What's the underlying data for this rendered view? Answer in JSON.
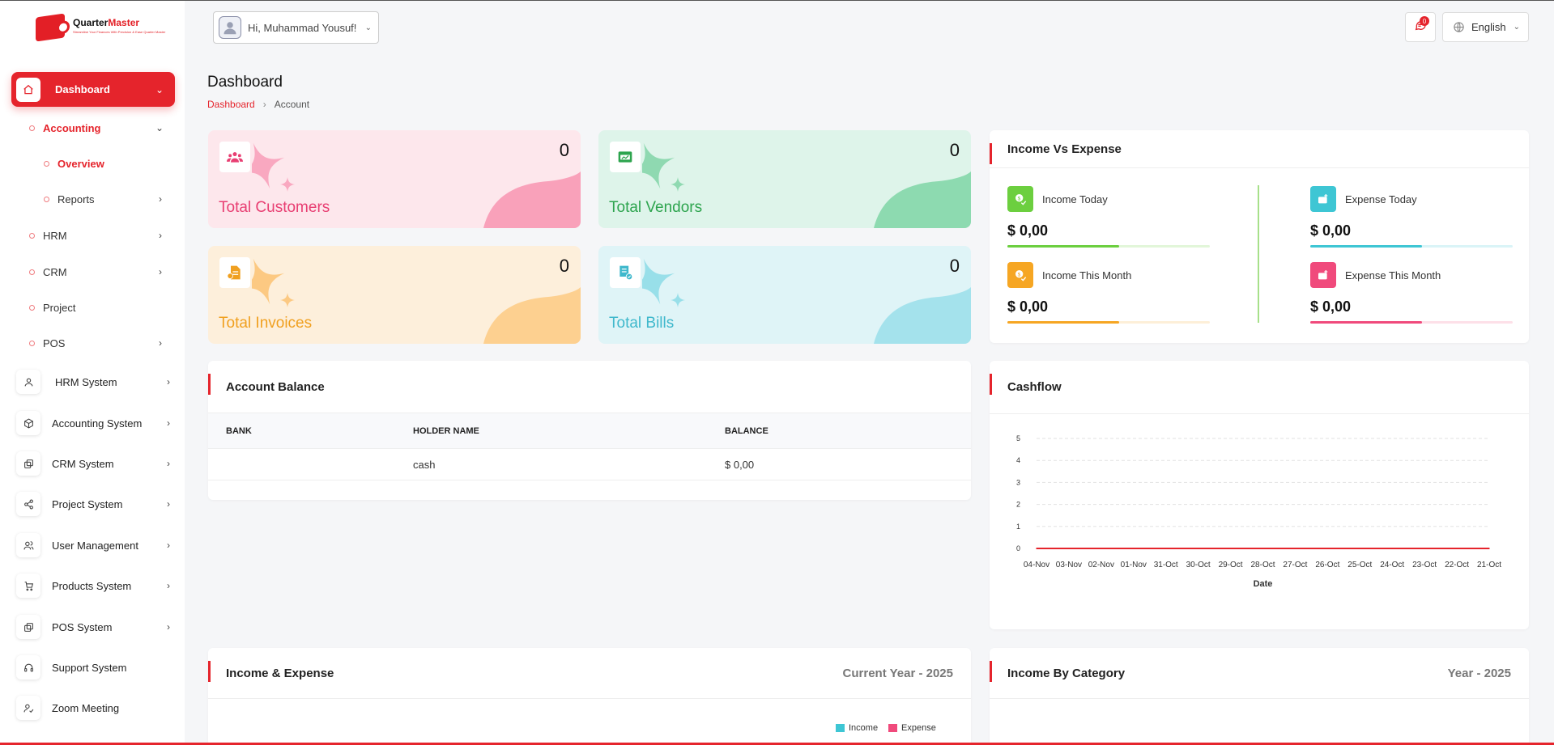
{
  "brand": {
    "name_a": "Quarter",
    "name_b": "Master",
    "tagline": "Streamline Your Finances With Precision & Ease Quarter Master",
    "color": "#e31f26"
  },
  "header": {
    "greeting": "Hi, Muhammad Yousuf!",
    "notifications": "0",
    "language": "English"
  },
  "sidebar": {
    "dashboard": "Dashboard",
    "accounting": "Accounting",
    "overview": "Overview",
    "reports": "Reports",
    "hrm": "HRM",
    "crm": "CRM",
    "project": "Project",
    "pos": "POS",
    "systems": [
      {
        "label": "HRM System",
        "icon": "user-icon"
      },
      {
        "label": "Accounting System",
        "icon": "box-icon"
      },
      {
        "label": "CRM System",
        "icon": "layers-icon"
      },
      {
        "label": "Project System",
        "icon": "share-icon"
      },
      {
        "label": "User Management",
        "icon": "users-icon"
      },
      {
        "label": "Products System",
        "icon": "cart-icon"
      },
      {
        "label": "POS System",
        "icon": "layers-icon"
      },
      {
        "label": "Support System",
        "icon": "headset-icon"
      },
      {
        "label": "Zoom Meeting",
        "icon": "user-check-icon"
      }
    ]
  },
  "page": {
    "title": "Dashboard",
    "breadcrumb": [
      "Dashboard",
      "Account"
    ]
  },
  "stats": [
    {
      "label": "Total Customers",
      "value": "0",
      "color": "#e83e72"
    },
    {
      "label": "Total Vendors",
      "value": "0",
      "color": "#2da44e"
    },
    {
      "label": "Total Invoices",
      "value": "0",
      "color": "#f0a020"
    },
    {
      "label": "Total Bills",
      "value": "0",
      "color": "#3fb8cc"
    }
  ],
  "income_vs_expense": {
    "title": "Income Vs Expense",
    "items": [
      {
        "label": "Income Today",
        "amount": "$ 0,00",
        "color": "#6ccf3f"
      },
      {
        "label": "Expense Today",
        "amount": "$ 0,00",
        "color": "#3ec6d4"
      },
      {
        "label": "Income This Month",
        "amount": "$ 0,00",
        "color": "#f6a623"
      },
      {
        "label": "Expense This Month",
        "amount": "$ 0,00",
        "color": "#f04a7c"
      }
    ]
  },
  "account_balance": {
    "title": "Account Balance",
    "columns": [
      "BANK",
      "HOLDER NAME",
      "BALANCE"
    ],
    "rows": [
      {
        "bank": "",
        "holder": "cash",
        "balance": "$ 0,00"
      }
    ]
  },
  "cashflow": {
    "title": "Cashflow"
  },
  "chart_data": {
    "type": "line",
    "categories": [
      "04-Nov",
      "03-Nov",
      "02-Nov",
      "01-Nov",
      "31-Oct",
      "30-Oct",
      "29-Oct",
      "28-Oct",
      "27-Oct",
      "26-Oct",
      "25-Oct",
      "24-Oct",
      "23-Oct",
      "22-Oct",
      "21-Oct"
    ],
    "series": [
      {
        "values": [
          0,
          0,
          0,
          0,
          0,
          0,
          0,
          0,
          0,
          0,
          0,
          0,
          0,
          0,
          0
        ],
        "color": "#e5242c"
      }
    ],
    "xlabel": "Date",
    "ylabel": "",
    "ylim": [
      0,
      5
    ],
    "yticks": [
      0,
      1,
      2,
      3,
      4,
      5
    ],
    "grid": true
  },
  "income_expense": {
    "title": "Income & Expense",
    "period": "Current Year - 2025",
    "legend": [
      {
        "name": "Income",
        "color": "#3ec6d4"
      },
      {
        "name": "Expense",
        "color": "#f04a7c"
      }
    ]
  },
  "income_by_category": {
    "title": "Income By Category",
    "period": "Year - 2025"
  }
}
